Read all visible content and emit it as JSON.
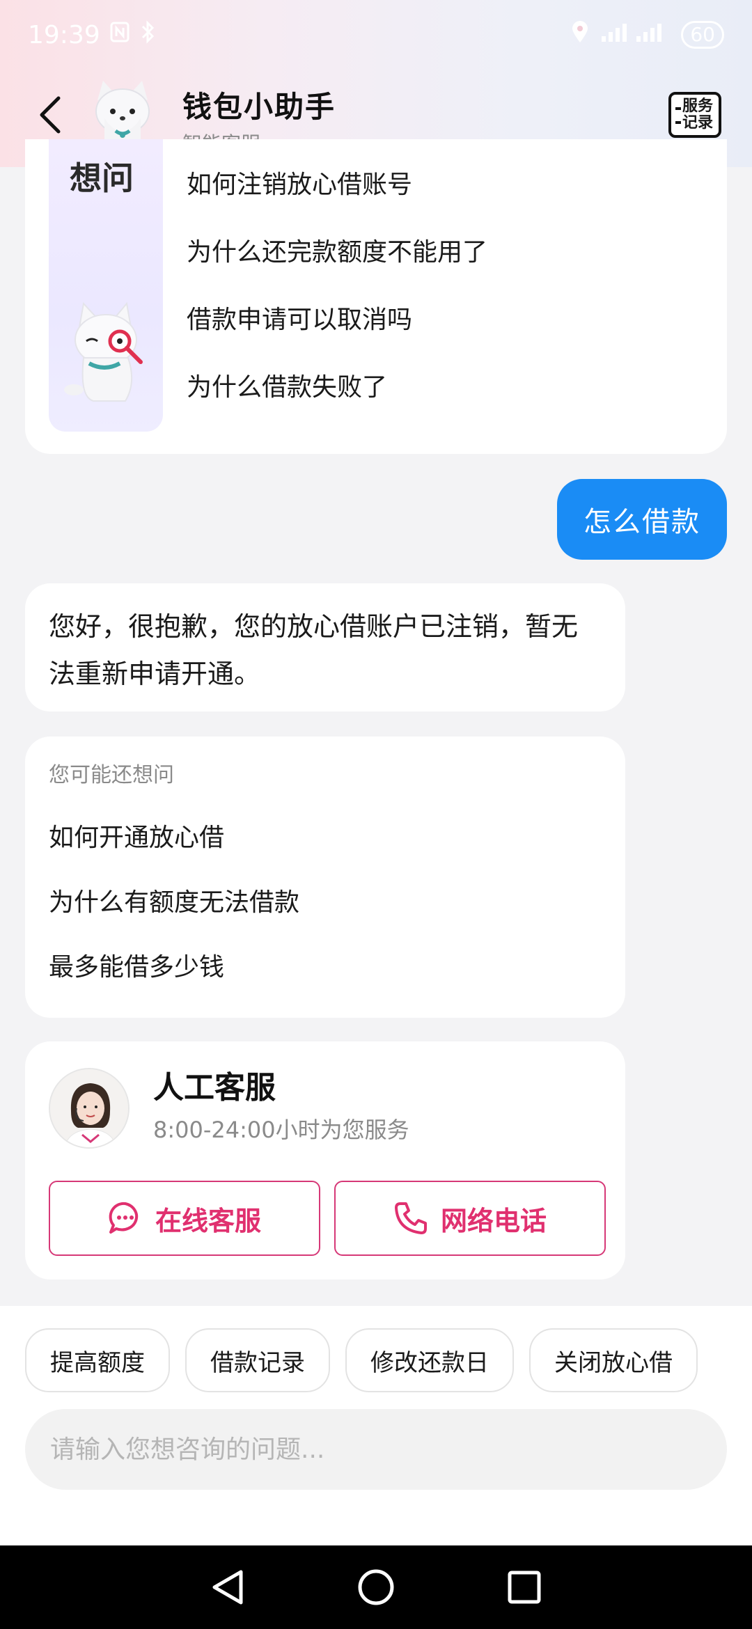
{
  "status_bar": {
    "time": "19:39",
    "battery": "60"
  },
  "header": {
    "title": "钱包小助手",
    "subtitle": "智能客服",
    "service_record": "服务记录"
  },
  "top_card": {
    "mascot_text": "想问",
    "questions": [
      "如何注销放心借账号",
      "为什么还完款额度不能用了",
      "借款申请可以取消吗",
      "为什么借款失败了"
    ]
  },
  "user_message": "怎么借款",
  "bot_reply": "您好，很抱歉，您的放心借账户已注销，暂无法重新申请开通。",
  "suggestions": {
    "title": "您可能还想问",
    "items": [
      "如何开通放心借",
      "为什么有额度无法借款",
      "最多能借多少钱"
    ]
  },
  "agent": {
    "name": "人工客服",
    "hours": "8:00-24:00小时为您服务",
    "online_label": "在线客服",
    "phone_label": "网络电话"
  },
  "quick_chips": [
    "提高额度",
    "借款记录",
    "修改还款日",
    "关闭放心借"
  ],
  "input": {
    "placeholder": "请输入您想咨询的问题...",
    "value": ""
  },
  "colors": {
    "accent_blue": "#1a8cf5",
    "accent_pink": "#e0306f"
  }
}
